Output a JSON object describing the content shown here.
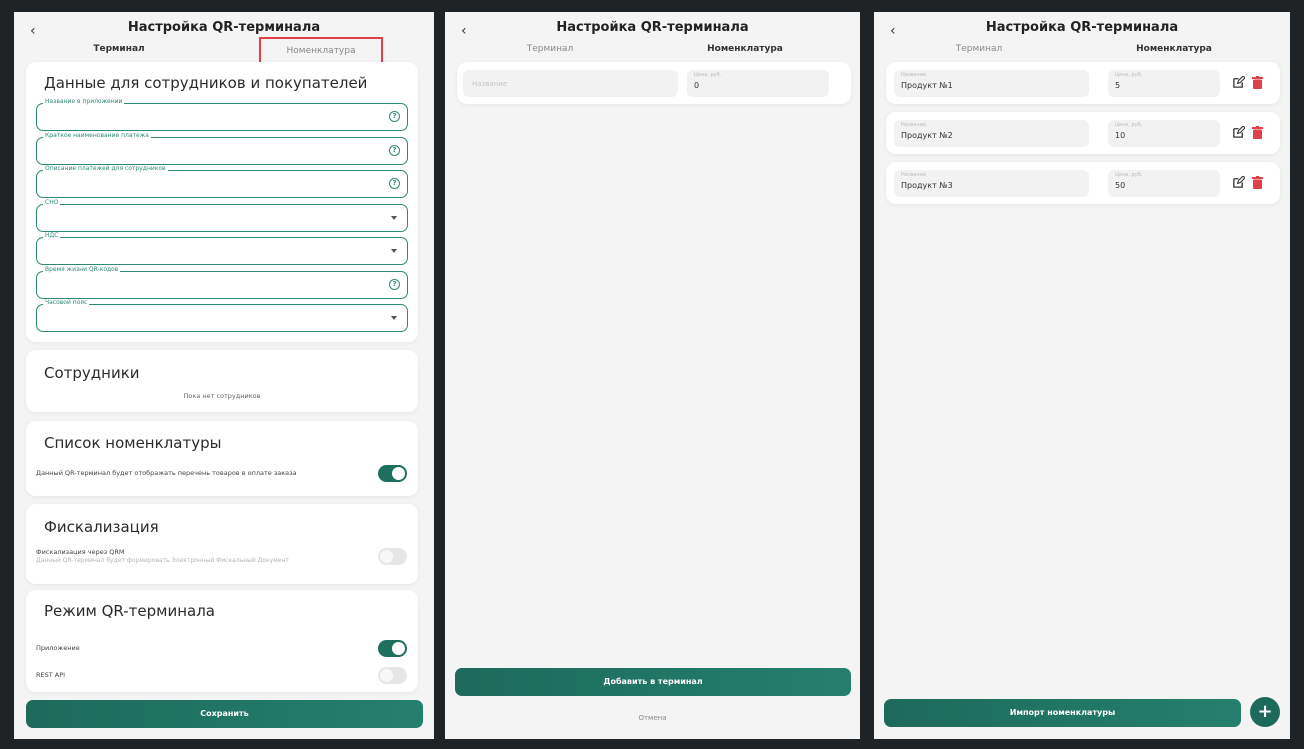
{
  "panel1": {
    "back_icon": "‹",
    "title": "Настройка QR-терминала",
    "tabs": [
      {
        "label": "Терминал"
      },
      {
        "label": "Номенклатура"
      }
    ],
    "data_section": {
      "title": "Данные для сотрудников и покупателей",
      "fields": [
        {
          "label": "Название в приложении",
          "icon": "help-icon"
        },
        {
          "label": "Краткое наименование платежа",
          "icon": "help-icon"
        },
        {
          "label": "Описание платежей для сотрудников",
          "icon": "help-icon"
        },
        {
          "label": "СНО",
          "icon": "dropdown-icon"
        },
        {
          "label": "НДС",
          "icon": "dropdown-icon"
        },
        {
          "label": "Время жизни QR-кодов",
          "icon": "help-icon"
        },
        {
          "label": "Часовой пояс",
          "icon": "dropdown-icon"
        }
      ]
    },
    "employees": {
      "title": "Сотрудники",
      "empty_text": "Пока нет сотрудников"
    },
    "nomenclature": {
      "title": "Список номенклатуры",
      "toggle_label": "Данный QR-терминал будет отображать перечень товаров в оплате заказа",
      "toggle_on": true
    },
    "fiscal": {
      "title": "Фискализация",
      "toggle_label": "Фискализация через QRM",
      "toggle_sub": "Данный QR-терминал будет формировать Электронный Фискальный Документ",
      "toggle_on": false
    },
    "mode": {
      "title": "Режим QR-терминала",
      "app_label": "Приложение",
      "app_on": true,
      "api_label": "REST API",
      "api_on": false
    },
    "save_label": "Сохранить"
  },
  "panel2": {
    "back_icon": "‹",
    "title": "Настройка QR-терминала",
    "tabs": [
      {
        "label": "Терминал"
      },
      {
        "label": "Номенклатура"
      }
    ],
    "name_placeholder": "Название",
    "price_label": "Цена, руб.",
    "price_value": "0",
    "add_label": "Добавить в терминал",
    "cancel_label": "Отмена"
  },
  "panel3": {
    "back_icon": "‹",
    "title": "Настройка QR-терминала",
    "tabs": [
      {
        "label": "Терминал"
      },
      {
        "label": "Номенклатура"
      }
    ],
    "name_label": "Название",
    "price_label": "Цена, руб.",
    "products": [
      {
        "name": "Продукт №1",
        "price": "5"
      },
      {
        "name": "Продукт №2",
        "price": "10"
      },
      {
        "name": "Продукт №3",
        "price": "50"
      }
    ],
    "import_label": "Импорт номенклатуры",
    "fab_icon": "+"
  },
  "colors": {
    "accent": "#1f6f5e",
    "field_border": "#2e8a76",
    "delete": "#e0404a",
    "highlight": "#e0404a"
  }
}
